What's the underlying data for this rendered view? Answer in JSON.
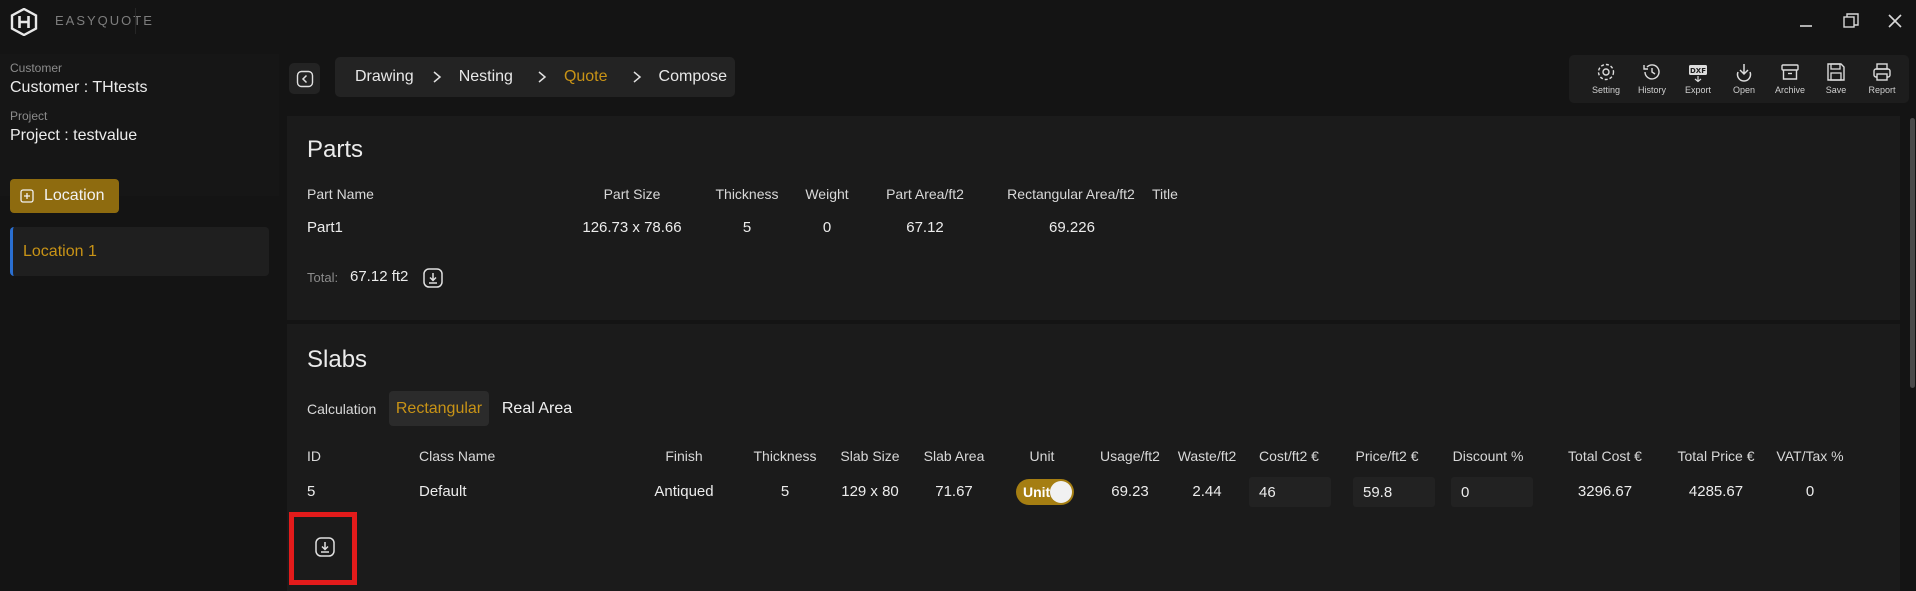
{
  "app": {
    "brand": "EASYQUOTE"
  },
  "sidebar": {
    "customer_label": "Customer",
    "customer_value": "Customer : THtests",
    "project_label": "Project",
    "project_value": "Project : testvalue",
    "location_button": "Location",
    "locations": [
      "Location 1"
    ]
  },
  "breadcrumb": [
    "Drawing",
    "Nesting",
    "Quote",
    "Compose"
  ],
  "breadcrumb_active": "Quote",
  "toolbar": {
    "setting": "Setting",
    "history": "History",
    "export": "Export",
    "open": "Open",
    "archive": "Archive",
    "save": "Save",
    "report": "Report"
  },
  "parts": {
    "title": "Parts",
    "headers": {
      "name": "Part Name",
      "size": "Part Size",
      "thickness": "Thickness",
      "weight": "Weight",
      "area": "Part Area/ft2",
      "rect_area": "Rectangular Area/ft2",
      "title": "Title"
    },
    "row": {
      "name": "Part1",
      "size": "126.73 x 78.66",
      "thickness": "5",
      "weight": "0",
      "area": "67.12",
      "rect_area": "69.226"
    },
    "total_label": "Total:",
    "total_value": "67.12 ft2"
  },
  "slabs": {
    "title": "Slabs",
    "calculation_label": "Calculation",
    "calc_options": [
      "Rectangular",
      "Real Area"
    ],
    "calc_selected": "Rectangular",
    "headers": {
      "id": "ID",
      "class": "Class Name",
      "finish": "Finish",
      "thickness": "Thickness",
      "size": "Slab Size",
      "area": "Slab Area",
      "unit": "Unit",
      "usage": "Usage/ft2",
      "waste": "Waste/ft2",
      "cost": "Cost/ft2 €",
      "price": "Price/ft2 €",
      "discount": "Discount %",
      "total_cost": "Total Cost €",
      "total_price": "Total Price €",
      "vat": "VAT/Tax %"
    },
    "row": {
      "id": "5",
      "class": "Default",
      "finish": "Antiqued",
      "thickness": "5",
      "size": "129 x 80",
      "area": "71.67",
      "unit_toggle": "Unit",
      "usage": "69.23",
      "waste": "2.44",
      "cost": "46",
      "price": "59.8",
      "discount": "0",
      "total_cost": "3296.67",
      "total_price": "4285.67",
      "vat": "0"
    }
  },
  "colors": {
    "accent": "#c89316",
    "button_gold": "#8e6b0f",
    "highlight": "#e31b1b",
    "location_border": "#2a6fd1"
  }
}
